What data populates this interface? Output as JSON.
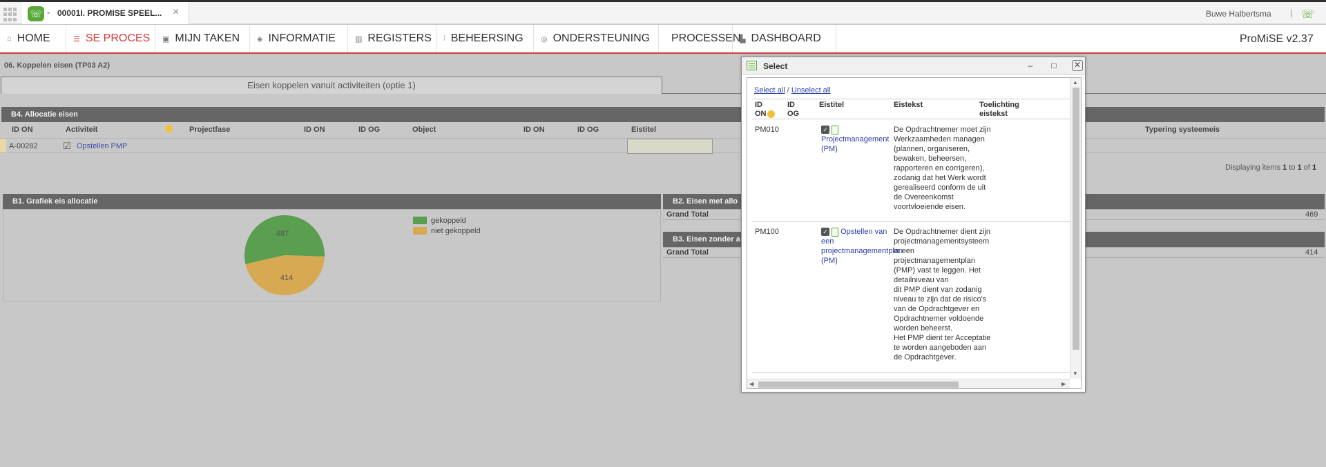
{
  "tabbar": {
    "tab_title": "00001I. PROMISE SPEEL...",
    "user_name": "Buwe Halbertsma",
    "separator": "|"
  },
  "menu": {
    "items": [
      {
        "label": "HOME",
        "icon": "home-icon"
      },
      {
        "label": "SE PROCES",
        "icon": "list-icon"
      },
      {
        "label": "MIJN TAKEN",
        "icon": "clipboard-icon"
      },
      {
        "label": "INFORMATIE",
        "icon": "layers-icon"
      },
      {
        "label": "REGISTERS",
        "icon": "book-icon"
      },
      {
        "label": "BEHEERSING",
        "icon": "sliders-icon"
      },
      {
        "label": "ONDERSTEUNING",
        "icon": "lifebuoy-icon"
      },
      {
        "label": "PROCESSEN",
        "icon": ""
      },
      {
        "label": "DASHBOARD",
        "icon": "bar-chart-icon"
      }
    ],
    "brand": "ProMiSE v2.37"
  },
  "page": {
    "breadcrumb": "06. Koppelen eisen (TP03 A2)",
    "subtab": "Eisen koppelen vanuit activiteiten (optie 1)"
  },
  "b4": {
    "title": "B4. Allocatie eisen",
    "columns": [
      "ID ON",
      "Activiteit",
      "Projectfase",
      "ID ON",
      "ID OG",
      "Object",
      "ID ON",
      "ID OG",
      "Eistitel",
      "Typering systeemeis"
    ],
    "row": {
      "id": "A-00282",
      "activity": "Opstellen PMP"
    },
    "displaying_prefix": "Displaying items",
    "displaying_from": "1",
    "displaying_to_word": "to",
    "displaying_to": "1",
    "displaying_of_word": "of",
    "displaying_total": "1"
  },
  "b1": {
    "title": "B1. Grafiek eis allocatie",
    "legend": [
      {
        "label": "gekoppeld",
        "color": "#5a9e4f"
      },
      {
        "label": "niet gekoppeld",
        "color": "#d8a953"
      }
    ]
  },
  "chart_data": {
    "type": "pie",
    "categories": [
      "gekoppeld",
      "niet gekoppeld"
    ],
    "values": [
      487,
      414
    ],
    "colors": [
      "#5a9e4f",
      "#d8a953"
    ],
    "legend": "right"
  },
  "b2": {
    "title": "B2. Eisen met allo",
    "grand_total_label": "Grand Total",
    "grand_total": "469"
  },
  "b3": {
    "title": "B3. Eisen zonder a",
    "grand_total_label": "Grand Total",
    "grand_total": "414"
  },
  "popup": {
    "title": "Select",
    "select_all": "Select all",
    "slash": "/",
    "unselect_all": "Unselect all",
    "columns": {
      "id_on": "ID\nON",
      "id_og": "ID\nOG",
      "eistitel": "Eistitel",
      "eistekst": "Eistekst",
      "toelichting": "Toelichting\neistekst"
    },
    "rows": [
      {
        "id": "PM010",
        "title": "Projectmanagement (PM)",
        "text": "De Opdrachtnemer moet zijn Werkzaamheden managen (plannen, organiseren, bewaken, beheersen, rapporteren en corrigeren),\nzodanig dat het Werk wordt gerealiseerd conform de uit de Overeenkomst voortvloeiende eisen."
      },
      {
        "id": "PM100",
        "title": "Opstellen van een projectmanagementplan (PM)",
        "text": "De Opdrachtnemer dient zijn projectmanagementsysteem in een projectmanagementplan (PMP) vast te leggen. Het detailniveau van\ndit PMP dient van zodanig niveau te zijn dat de risico's van de Opdrachtgever en Opdrachtnemer voldoende worden beheerst.\nHet PMP dient ter Acceptatie te worden aangeboden aan de Opdrachtgever."
      }
    ]
  }
}
